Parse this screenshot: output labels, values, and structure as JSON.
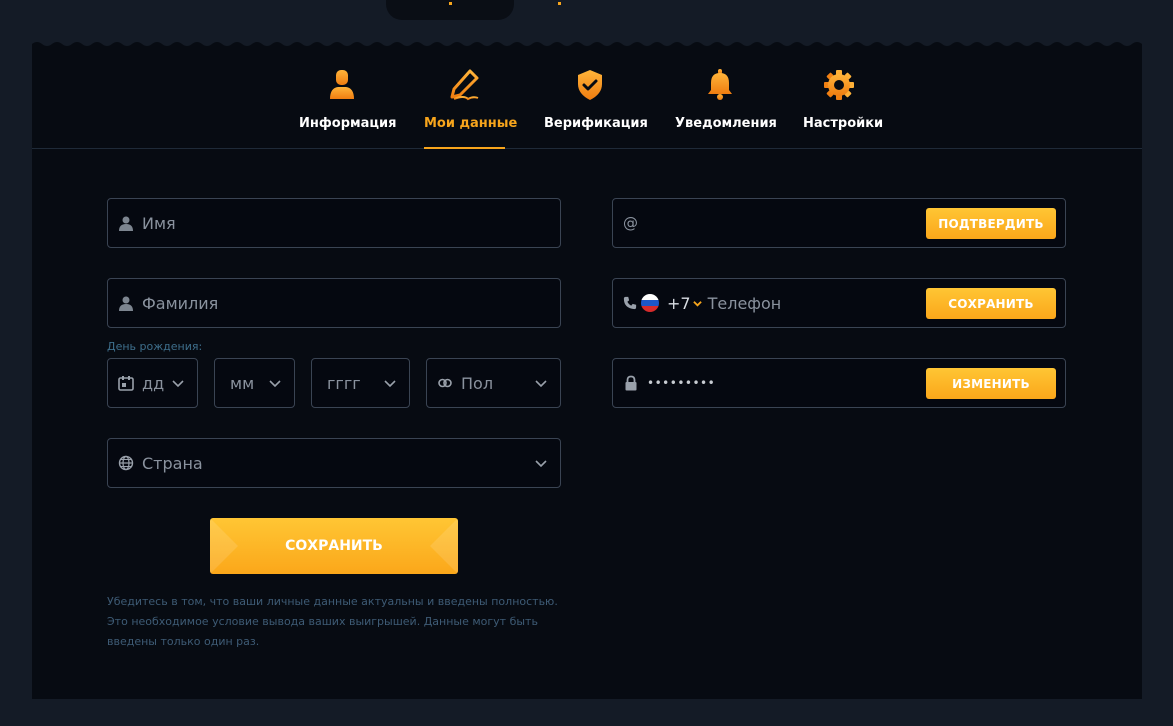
{
  "tabs": [
    {
      "label": "Информация",
      "icon": "user-icon"
    },
    {
      "label": "Мои данные",
      "icon": "pencil-icon",
      "active": true
    },
    {
      "label": "Верификация",
      "icon": "shield-check-icon"
    },
    {
      "label": "Уведомления",
      "icon": "bell-icon"
    },
    {
      "label": "Настройки",
      "icon": "gear-icon"
    }
  ],
  "form": {
    "first_name_placeholder": "Имя",
    "last_name_placeholder": "Фамилия",
    "birthday_label": "День рождения:",
    "day_placeholder": "дд",
    "month_placeholder": "мм",
    "year_placeholder": "гггг",
    "gender_placeholder": "Пол",
    "country_placeholder": "Страна",
    "save_label": "СОХРАНИТЬ",
    "note": "Убедитесь в том, что ваши личные данные актуальны и введены полностью. Это необходимое условие вывода ваших выигрышей. Данные могут быть введены только один раз."
  },
  "contact": {
    "email_placeholder": "@",
    "email_button": "ПОДТВЕРДИТЬ",
    "phone_code": "+7",
    "phone_placeholder": "Телефон",
    "phone_button": "СОХРАНИТЬ",
    "password_value": "•••••••••",
    "password_button": "ИЗМЕНИТЬ"
  },
  "colors": {
    "accent": "#f7a51c",
    "background": "#070b12",
    "border": "#3a4453"
  }
}
